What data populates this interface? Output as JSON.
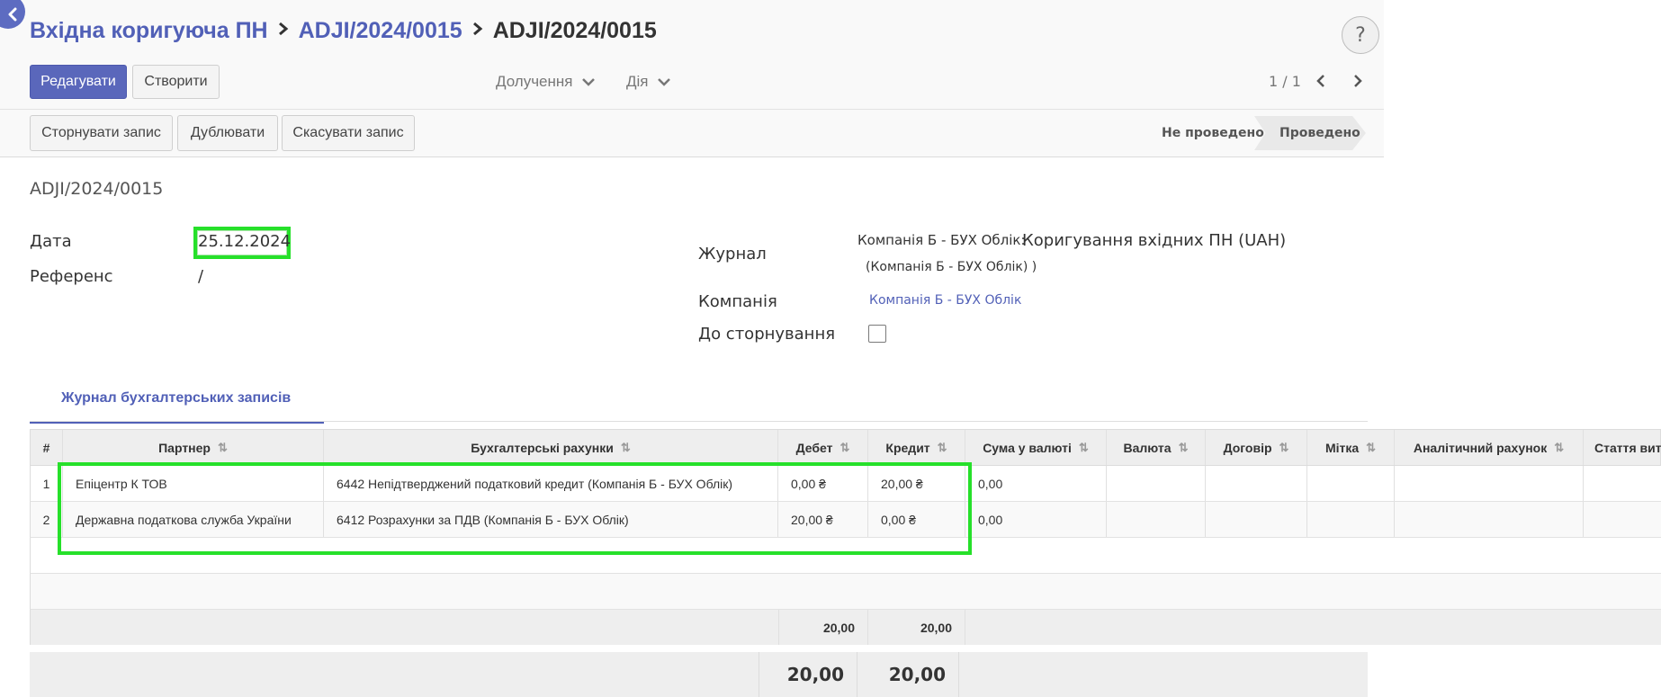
{
  "breadcrumb": {
    "root": "Вхідна коригуюча ПН",
    "parent": "ADJI/2024/0015",
    "current": "ADJI/2024/0015"
  },
  "help_label": "?",
  "toolbar": {
    "edit_label": "Редагувати",
    "create_label": "Створити",
    "attachments_label": "Долучення",
    "action_label": "Дія",
    "pager": "1 / 1"
  },
  "actions": {
    "reverse_label": "Сторнувати запис",
    "duplicate_label": "Дублювати",
    "cancel_label": "Скасувати запис"
  },
  "statusbar": {
    "draft": "Не проведено",
    "posted": "Проведено"
  },
  "form": {
    "name": "ADJI/2024/0015",
    "date_label": "Дата",
    "date_value": "25.12.2024",
    "ref_label": "Референс",
    "ref_value": "/",
    "journal_label": "Журнал",
    "journal_prefix": "Компанія Б - БУХ Облік:",
    "journal_value": "Коригування вхідних ПН (UAH)",
    "journal_sub": "(Компанія Б - БУХ Облік) )",
    "company_label": "Компанія",
    "company_value": "Компанія Б - БУХ Облік",
    "to_reverse_label": "До сторнування"
  },
  "tab": {
    "label": "Журнал бухгалтерських записів"
  },
  "table": {
    "headers": {
      "num": "#",
      "partner": "Партнер",
      "account": "Бухгалтерські рахунки",
      "debit": "Дебет",
      "credit": "Кредит",
      "amount_currency": "Сума у валюті",
      "currency": "Валюта",
      "contract": "Договір",
      "label": "Мітка",
      "analytic": "Аналітичний рахунок",
      "expense_item": "Стаття вит"
    },
    "rows": [
      {
        "num": "1",
        "partner": "Епіцентр К ТОВ",
        "account": "6442 Непідтверджений податковий кредит (Компанія Б - БУХ Облік)",
        "debit": "0,00 ₴",
        "credit": "20,00 ₴",
        "amount_currency": "0,00"
      },
      {
        "num": "2",
        "partner": "Державна податкова служба України",
        "account": "6412 Розрахунки за ПДВ (Компанія Б - БУХ Облік)",
        "debit": "20,00 ₴",
        "credit": "0,00 ₴",
        "amount_currency": "0,00"
      }
    ],
    "totals": {
      "debit": "20,00",
      "credit": "20,00"
    }
  },
  "footer": {
    "debit_total": "20,00",
    "credit_total": "20,00"
  },
  "colors": {
    "brand": "#5a67bb",
    "link": "#5160b7",
    "highlight": "#26e02a"
  }
}
